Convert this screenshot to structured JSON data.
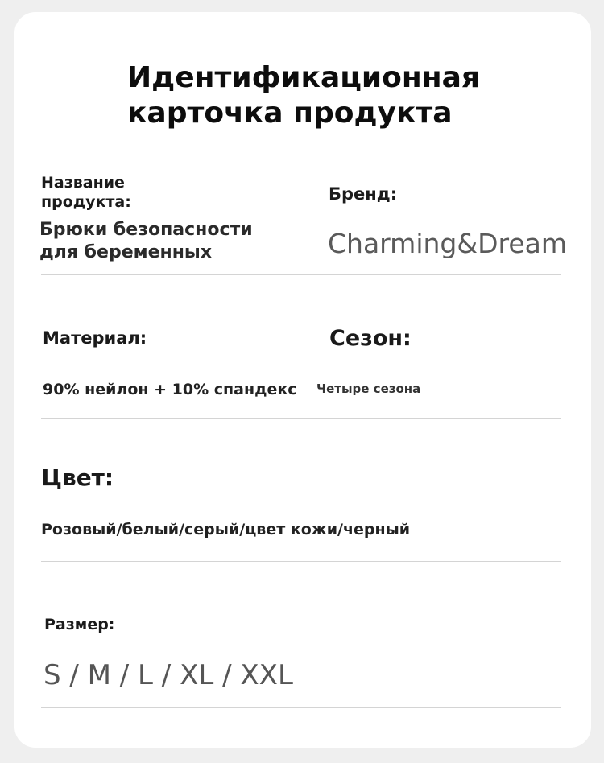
{
  "title": "Идентификационная карточка продукта",
  "product_name": {
    "label": "Название продукта:",
    "value": "Брюки безопасности для беременных"
  },
  "brand": {
    "label": "Бренд:",
    "value": "Charming&Dream"
  },
  "material": {
    "label": "Материал:",
    "value": "90% нейлон + 10% спандекс"
  },
  "season": {
    "label": "Сезон:",
    "value": "Четыре сезона"
  },
  "color": {
    "label": "Цвет:",
    "value": "Розовый/белый/серый/цвет кожи/черный"
  },
  "size": {
    "label": "Размер:",
    "value": "S / M / L / XL / XXL"
  }
}
